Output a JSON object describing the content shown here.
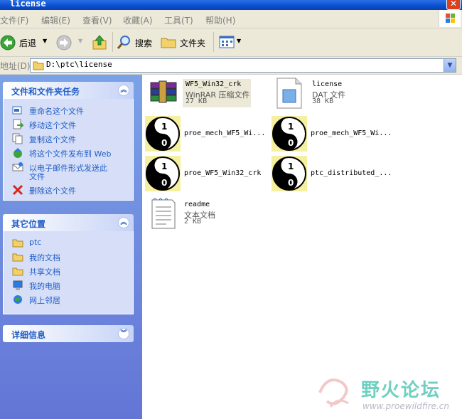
{
  "window": {
    "title": "license"
  },
  "menu": [
    "文件(F)",
    "编辑(E)",
    "查看(V)",
    "收藏(A)",
    "工具(T)",
    "帮助(H)"
  ],
  "toolbar": {
    "back_label": "后退",
    "search_label": "搜索",
    "folders_label": "文件夹"
  },
  "address": {
    "label": "地址(D)",
    "value": "D:\\ptc\\license"
  },
  "tasks_panel": {
    "title": "文件和文件夹任务",
    "items": [
      {
        "label": "重命名这个文件",
        "icon": "rename-icon"
      },
      {
        "label": "移动这个文件",
        "icon": "move-icon"
      },
      {
        "label": "复制这个文件",
        "icon": "copy-icon"
      },
      {
        "label": "将这个文件发布到 Web",
        "icon": "publish-web-icon"
      },
      {
        "label": "以电子邮件形式发送此",
        "label2": "文件",
        "icon": "email-icon"
      },
      {
        "label": "删除这个文件",
        "icon": "delete-icon"
      }
    ]
  },
  "places_panel": {
    "title": "其它位置",
    "items": [
      {
        "label": "ptc",
        "icon": "folder-icon"
      },
      {
        "label": "我的文档",
        "icon": "folder-icon"
      },
      {
        "label": "共享文档",
        "icon": "folder-icon"
      },
      {
        "label": "我的电脑",
        "icon": "computer-icon"
      },
      {
        "label": "网上邻居",
        "icon": "network-icon"
      }
    ]
  },
  "details_panel": {
    "title": "详细信息"
  },
  "files": [
    {
      "name": "WF5_Win32_crk",
      "type": "WinRAR 压缩文件",
      "size": "27 KB",
      "icon": "winrar-icon",
      "selected": true
    },
    {
      "name": "license",
      "type": "DAT 文件",
      "size": "38 KB",
      "icon": "dat-file-icon"
    },
    {
      "name": "proe_mech_WF5_Wi...",
      "icon": "yinyang-app-icon"
    },
    {
      "name": "proe_mech_WF5_Wi...",
      "icon": "yinyang-app-icon"
    },
    {
      "name": "proe_WF5_Win32_crk",
      "icon": "yinyang-app-icon"
    },
    {
      "name": "ptc_distributed_...",
      "icon": "yinyang-app-icon"
    },
    {
      "name": "readme",
      "type": "文本文档",
      "size": "2 KB",
      "icon": "text-file-icon"
    }
  ],
  "watermark": {
    "text": "野火论坛",
    "url": "www.proewildfire.cn"
  },
  "colors": {
    "titlebar": "#0a4fd0",
    "taskpane": "#6f8be0",
    "link": "#215dc6"
  }
}
